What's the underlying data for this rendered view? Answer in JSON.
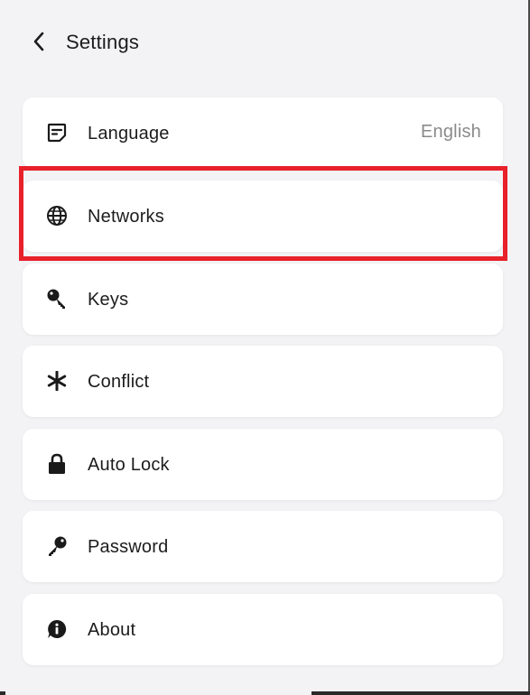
{
  "header": {
    "title": "Settings",
    "back_icon": "chevron-left-icon"
  },
  "settings": [
    {
      "id": "language",
      "label": "Language",
      "value": "English",
      "icon": "note-icon"
    },
    {
      "id": "networks",
      "label": "Networks",
      "icon": "globe-icon",
      "highlighted": true
    },
    {
      "id": "keys",
      "label": "Keys",
      "icon": "key-icon"
    },
    {
      "id": "conflict",
      "label": "Conflict",
      "icon": "asterisk-icon"
    },
    {
      "id": "auto-lock",
      "label": "Auto Lock",
      "icon": "lock-icon"
    },
    {
      "id": "password",
      "label": "Password",
      "icon": "password-key-icon"
    },
    {
      "id": "about",
      "label": "About",
      "icon": "info-icon"
    }
  ],
  "colors": {
    "background": "#f3f3f5",
    "card": "#ffffff",
    "highlight": "#e8202a",
    "secondary_text": "#8a8a8a"
  }
}
